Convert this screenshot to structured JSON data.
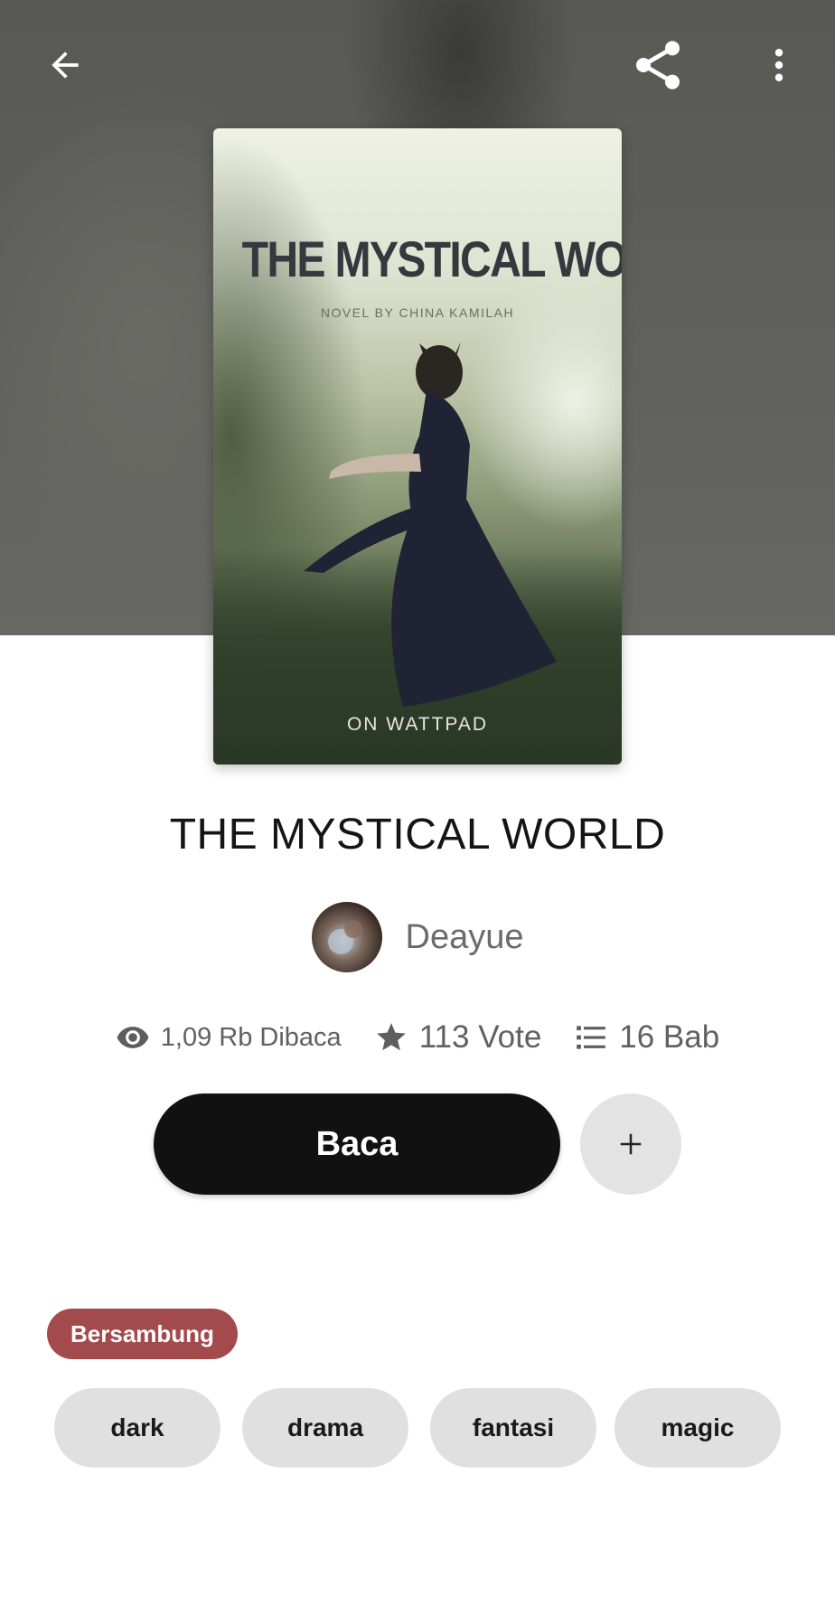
{
  "topbar": {
    "back_icon": "arrow-left-icon",
    "share_icon": "share-icon",
    "more_icon": "more-vertical-icon"
  },
  "cover": {
    "title": "THE MYSTICAL WORLD",
    "subtitle": "NOVEL BY CHINA KAMILAH",
    "footer": "ON WATTPAD"
  },
  "book": {
    "title": "THE MYSTICAL WORLD",
    "author": "Deayue"
  },
  "stats": {
    "reads": "1,09 Rb Dibaca",
    "votes": "113 Vote",
    "chapters": "16 Bab"
  },
  "actions": {
    "read_label": "Baca",
    "add_label": "+"
  },
  "status": {
    "label": "Bersambung",
    "color": "#a34b4c"
  },
  "tags": [
    "dark",
    "drama",
    "fantasi",
    "magic"
  ]
}
